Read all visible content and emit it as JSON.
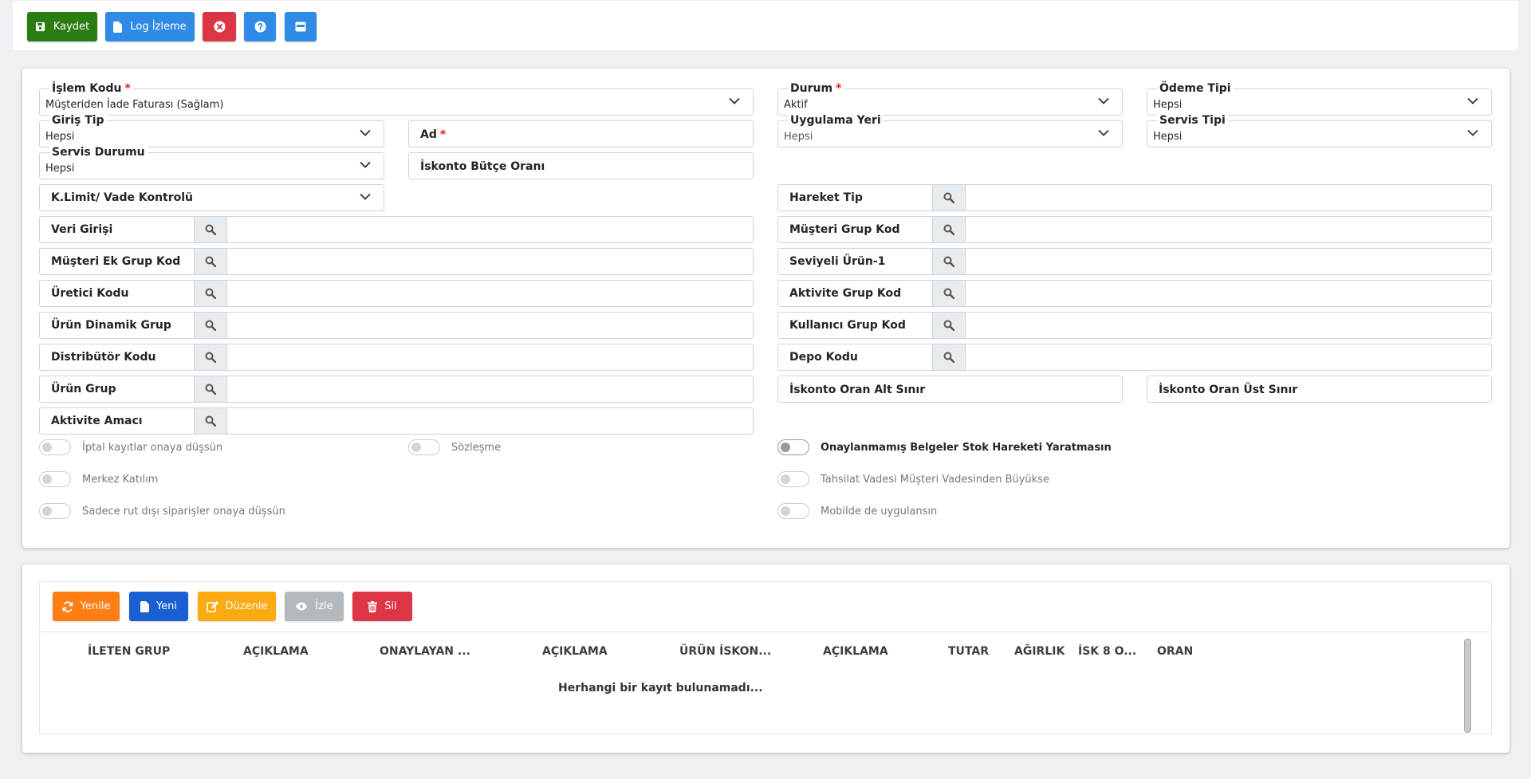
{
  "toolbar": {
    "save_label": "Kaydet",
    "log_label": "Log İzleme"
  },
  "form": {
    "islem_kodu": {
      "label": "İşlem Kodu",
      "value": "Müşteriden İade Faturası (Sağlam)"
    },
    "durum": {
      "label": "Durum",
      "value": "Aktif"
    },
    "odeme_tipi": {
      "label": "Ödeme Tipi",
      "value": "Hepsi"
    },
    "giris_tip": {
      "label": "Giriş Tip",
      "value": "Hepsi"
    },
    "ad": {
      "label": "Ad"
    },
    "uygulama_yeri": {
      "label": "Uygulama Yeri",
      "value": "Hepsi"
    },
    "servis_tipi": {
      "label": "Servis Tipi",
      "value": "Hepsi"
    },
    "servis_durumu": {
      "label": "Servis Durumu",
      "value": "Hepsi"
    },
    "iskonto_butce": {
      "label": "İskonto Bütçe Oranı"
    },
    "klimit": {
      "label": "K.Limit/ Vade Kontrolü"
    },
    "hareket_tip": {
      "label": "Hareket Tip"
    },
    "veri_girisi": {
      "label": "Veri Girişi"
    },
    "musteri_grup_kod": {
      "label": "Müşteri Grup Kod"
    },
    "musteri_ek_grup_kod": {
      "label": "Müşteri Ek Grup Kod"
    },
    "seviyeli_urun": {
      "label": "Seviyeli Ürün-1"
    },
    "uretici_kodu": {
      "label": "Üretici Kodu"
    },
    "aktivite_grup_kod": {
      "label": "Aktivite Grup Kod"
    },
    "urun_dinamik_grup": {
      "label": "Ürün Dinamik Grup"
    },
    "kullanici_grup_kod": {
      "label": "Kullanıcı Grup Kod"
    },
    "distributor_kodu": {
      "label": "Distribütör Kodu"
    },
    "depo_kodu": {
      "label": "Depo Kodu"
    },
    "urun_grup": {
      "label": "Ürün Grup"
    },
    "iskonto_alt": {
      "label": "İskonto Oran Alt Sınır"
    },
    "iskonto_ust": {
      "label": "İskonto Oran Üst Sınır"
    },
    "aktivite_amaci": {
      "label": "Aktivite Amacı"
    },
    "required_mark": "*"
  },
  "toggles": {
    "iptal": "İptal kayıtlar onaya düşsün",
    "sozlesme": "Sözleşme",
    "onaylanmamis": "Onaylanmamış Belgeler Stok Hareketi Yaratmasın",
    "merkez": "Merkez Katılım",
    "tahsilat": "Tahsilat Vadesi Müşteri Vadesinden Büyükse",
    "sadece_rut": "Sadece rut dışı siparişler onaya düşsün",
    "mobilde": "Mobilde de uygulansın"
  },
  "grid": {
    "buttons": {
      "refresh": "Yenile",
      "new": "Yeni",
      "edit": "Düzenle",
      "view": "İzle",
      "delete": "Sil"
    },
    "columns": [
      "İLETEN GRUP",
      "AÇIKLAMA",
      "ONAYLAYAN ...",
      "AÇIKLAMA",
      "ÜRÜN İSKON...",
      "AÇIKLAMA",
      "TUTAR",
      "AĞIRLIK",
      "İSK 8 O...",
      "ORAN"
    ],
    "empty_text": "Herhangi bir kayıt bulunamadı..."
  },
  "colors": {
    "save": "#2b7d12",
    "primary": "#2f8be6",
    "danger": "#dc3545",
    "refresh": "#fd7e14",
    "new": "#1a5fd1",
    "edit": "#fcaa12",
    "view": "#b4b9be"
  }
}
